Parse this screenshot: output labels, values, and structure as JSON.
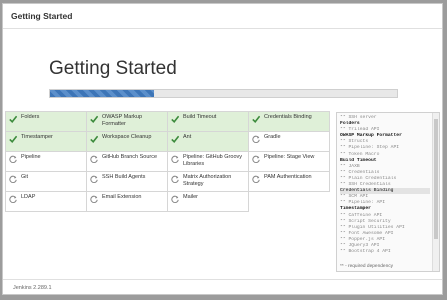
{
  "window": {
    "title": "Getting Started"
  },
  "hero": {
    "title": "Getting Started",
    "progress_percent": 30
  },
  "plugins": [
    {
      "name": "Folders",
      "status": "done"
    },
    {
      "name": "OWASP Markup Formatter",
      "status": "done"
    },
    {
      "name": "Build Timeout",
      "status": "done"
    },
    {
      "name": "Credentials Binding",
      "status": "done"
    },
    {
      "name": "Timestamper",
      "status": "done"
    },
    {
      "name": "Workspace Cleanup",
      "status": "done"
    },
    {
      "name": "Ant",
      "status": "done"
    },
    {
      "name": "Gradle",
      "status": "pending"
    },
    {
      "name": "Pipeline",
      "status": "pending"
    },
    {
      "name": "GitHub Branch Source",
      "status": "pending"
    },
    {
      "name": "Pipeline: GitHub Groovy Libraries",
      "status": "pending"
    },
    {
      "name": "Pipeline: Stage View",
      "status": "pending"
    },
    {
      "name": "Git",
      "status": "pending"
    },
    {
      "name": "SSH Build Agents",
      "status": "pending"
    },
    {
      "name": "Matrix Authorization Strategy",
      "status": "pending"
    },
    {
      "name": "PAM Authentication",
      "status": "pending"
    },
    {
      "name": "LDAP",
      "status": "pending"
    },
    {
      "name": "Email Extension",
      "status": "pending"
    },
    {
      "name": "Mailer",
      "status": "pending"
    }
  ],
  "log": {
    "lines": [
      {
        "text": "** SSH server",
        "style": "s"
      },
      {
        "text": "Folders",
        "style": "b"
      },
      {
        "text": "** Trilead API",
        "style": "s"
      },
      {
        "text": "OWASP Markup Formatter",
        "style": "b"
      },
      {
        "text": "** Structs",
        "style": "s"
      },
      {
        "text": "** Pipeline: Step API",
        "style": "s"
      },
      {
        "text": "** Token Macro",
        "style": "s"
      },
      {
        "text": "Build Timeout",
        "style": "b"
      },
      {
        "text": "** JAXB",
        "style": "s"
      },
      {
        "text": "** Credentials",
        "style": "s"
      },
      {
        "text": "** Plain Credentials",
        "style": "s"
      },
      {
        "text": "** SSH Credentials",
        "style": "s"
      },
      {
        "text": "Credentials Binding",
        "style": "hl"
      },
      {
        "text": "** SCM API",
        "style": "s"
      },
      {
        "text": "** Pipeline: API",
        "style": "s"
      },
      {
        "text": "Timestamper",
        "style": "b"
      },
      {
        "text": "** Caffeine API",
        "style": "s"
      },
      {
        "text": "** Script Security",
        "style": "s"
      },
      {
        "text": "** Plugin Utilities API",
        "style": "s"
      },
      {
        "text": "** Font Awesome API",
        "style": "s"
      },
      {
        "text": "** Popper.js API",
        "style": "s"
      },
      {
        "text": "** JQuery3 API",
        "style": "s"
      },
      {
        "text": "** Bootstrap 4 API",
        "style": "s"
      }
    ],
    "footer": "** - required dependency"
  },
  "footer": {
    "version": "Jenkins 2.289.1"
  },
  "colors": {
    "done_bg": "#dff0d8",
    "check": "#3c8b3c",
    "spinner": "#8a8a8a",
    "progress": "#3d75b7"
  }
}
